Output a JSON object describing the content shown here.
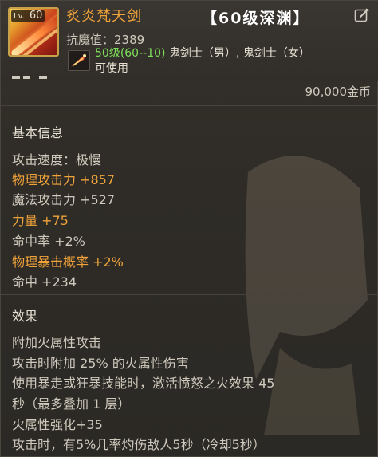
{
  "item": {
    "level_label": "Lv.",
    "level": "60",
    "name": "炙炎梵天剑",
    "tag": "【60级深渊】",
    "resist": "抗魔值：2389",
    "requirement_level": "50级(60--10)",
    "requirement_classes": " 鬼剑士（男）, 鬼剑士（女）",
    "usable": "可使用",
    "price": "90,000金币"
  },
  "basic": {
    "title": "基本信息",
    "stats": [
      {
        "text": "攻击速度：极慢",
        "highlight": false
      },
      {
        "text": "物理攻击力 +857",
        "highlight": true
      },
      {
        "text": "魔法攻击力 +527",
        "highlight": false
      },
      {
        "text": "力量 +75",
        "highlight": true
      },
      {
        "text": "命中率 +2%",
        "highlight": false
      },
      {
        "text": "物理暴击概率 +2%",
        "highlight": true
      },
      {
        "text": "命中 +234",
        "highlight": false
      }
    ]
  },
  "effects": {
    "title": "效果",
    "lines": [
      "附加火属性攻击",
      "攻击时附加 25% 的火属性伤害",
      "使用暴走或狂暴技能时，激活愤怒之火效果 45",
      "秒（最多叠加 1 层）",
      "火属性强化+35",
      "攻击时，有5%几率灼伤敌人5秒（冷却5秒）"
    ]
  },
  "colors": {
    "name": "#f0a33a",
    "highlight": "#f0a33a",
    "requirement": "#7ee05a",
    "text": "#cfc9bd"
  },
  "icons": [
    "sword-item-icon",
    "edit-icon",
    "class-mini-icon"
  ]
}
